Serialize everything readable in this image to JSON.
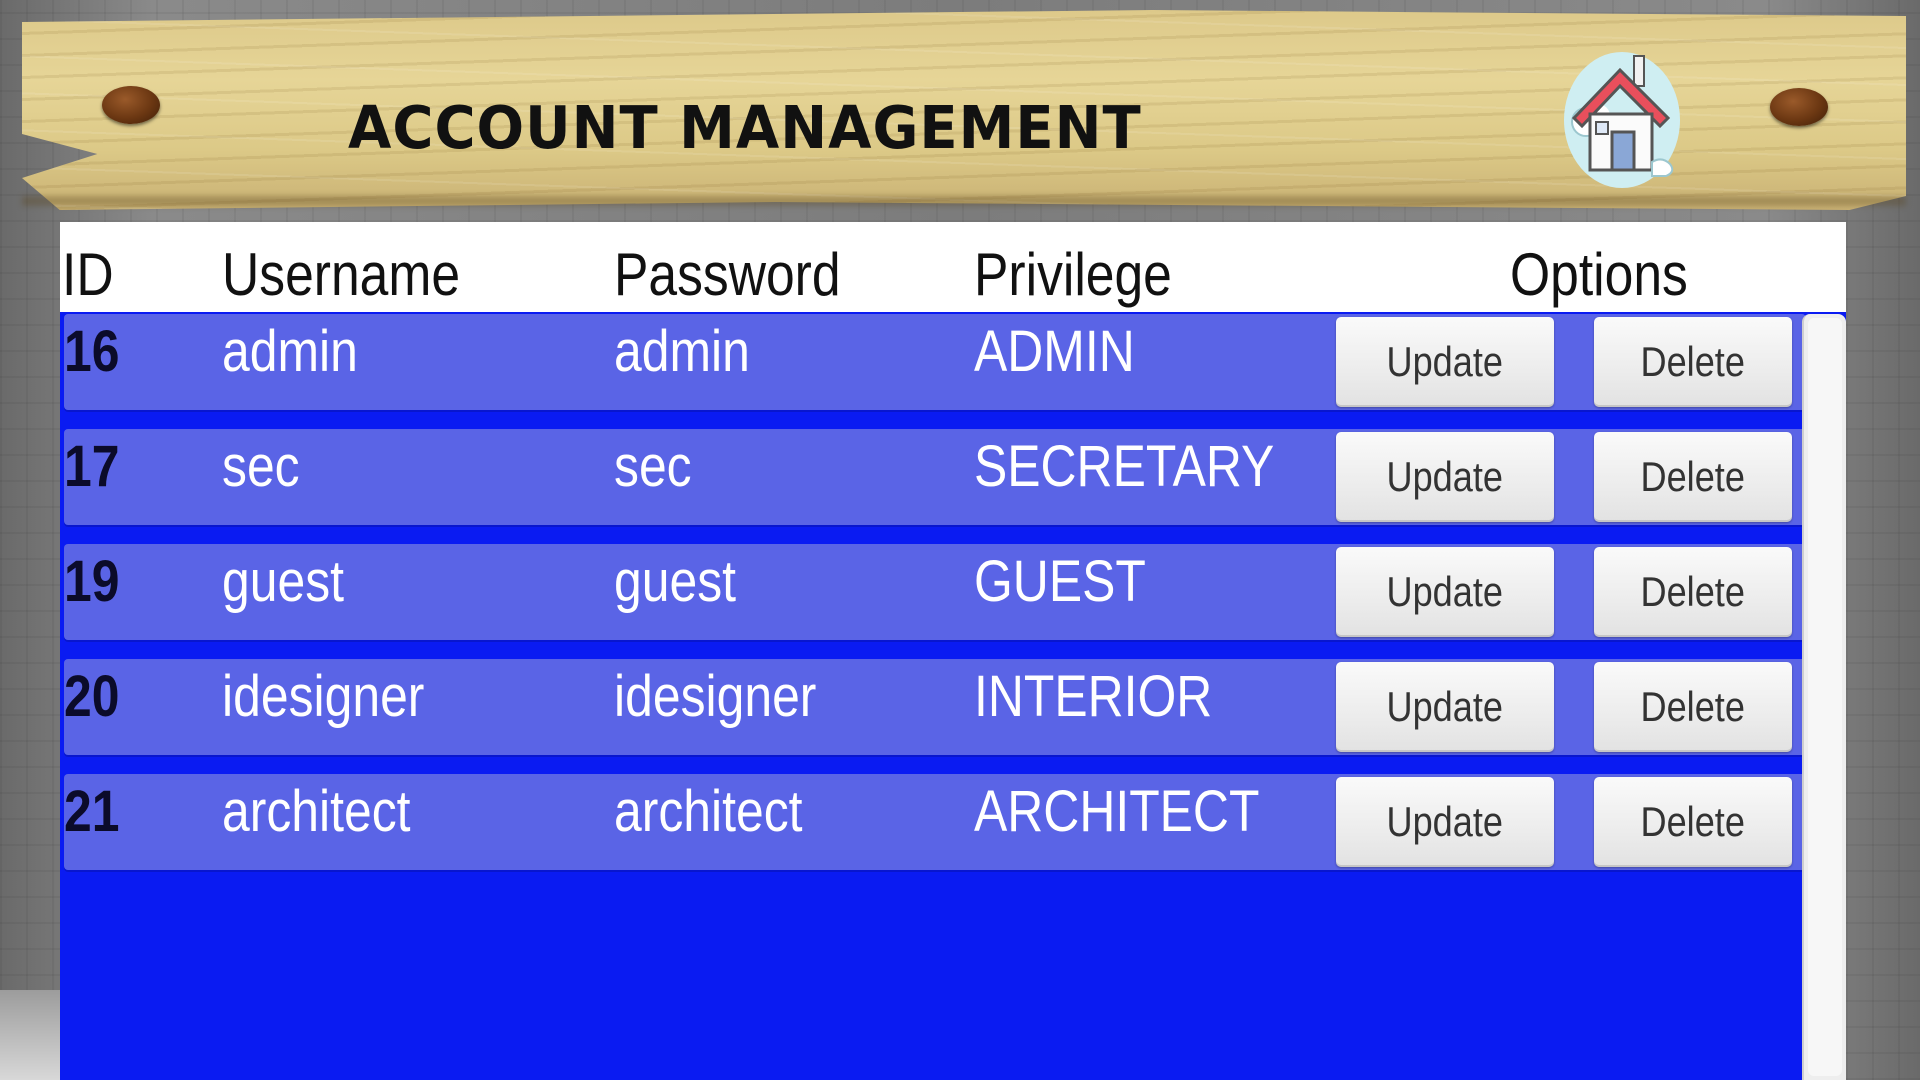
{
  "header": {
    "title": "ACCOUNT MANAGEMENT",
    "home_icon": "house-icon"
  },
  "table": {
    "columns": {
      "id": "ID",
      "username": "Username",
      "password": "Password",
      "privilege": "Privilege",
      "options": "Options"
    },
    "rows": [
      {
        "id": "16",
        "username": "admin",
        "password": "admin",
        "privilege": "ADMIN",
        "update": "Update",
        "delete": "Delete"
      },
      {
        "id": "17",
        "username": "sec",
        "password": "sec",
        "privilege": "SECRETARY",
        "update": "Update",
        "delete": "Delete"
      },
      {
        "id": "19",
        "username": "guest",
        "password": "guest",
        "privilege": "GUEST",
        "update": "Update",
        "delete": "Delete"
      },
      {
        "id": "20",
        "username": "idesigner",
        "password": "idesigner",
        "privilege": "INTERIOR",
        "update": "Update",
        "delete": "Delete"
      },
      {
        "id": "21",
        "username": "architect",
        "password": "architect",
        "privilege": "ARCHITECT",
        "update": "Update",
        "delete": "Delete"
      }
    ]
  },
  "colors": {
    "panel": "#0a1bf2",
    "row": "#5a64e6",
    "wood": "#e0cd8c"
  }
}
